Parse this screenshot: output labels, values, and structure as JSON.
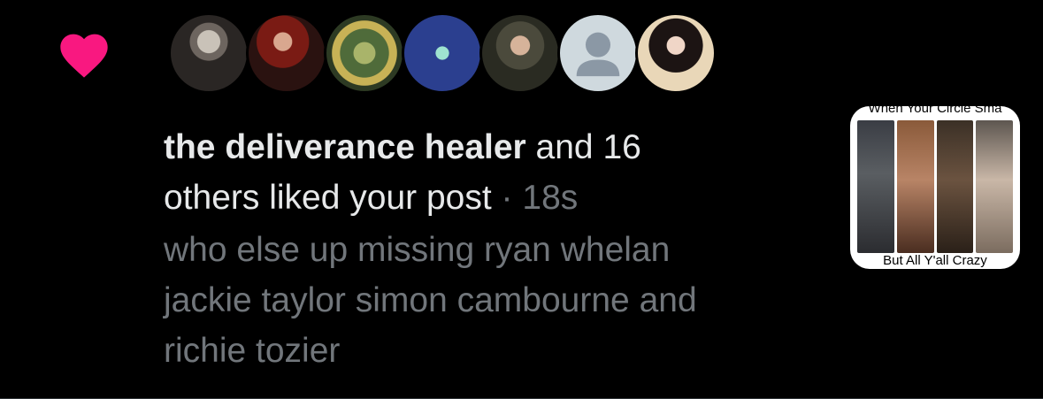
{
  "notification": {
    "type": "like",
    "heart_color": "#f91880",
    "actor_name": "the deliverance healer",
    "summary_rest_line1": " and 16",
    "summary_line2": "others liked your post",
    "separator": " · ",
    "timestamp": "18s",
    "post_text_lines": [
      "who else up missing ryan whelan",
      "jackie taylor simon cambourne and",
      "richie tozier"
    ],
    "avatars": [
      {
        "name": "avatar-1"
      },
      {
        "name": "avatar-2"
      },
      {
        "name": "avatar-3"
      },
      {
        "name": "avatar-4"
      },
      {
        "name": "avatar-5"
      },
      {
        "name": "avatar-default-6"
      },
      {
        "name": "avatar-7"
      }
    ],
    "media_thumbnail": {
      "caption_top": "When Your Circle Sma",
      "caption_bottom": "But All Y'all Crazy"
    }
  }
}
